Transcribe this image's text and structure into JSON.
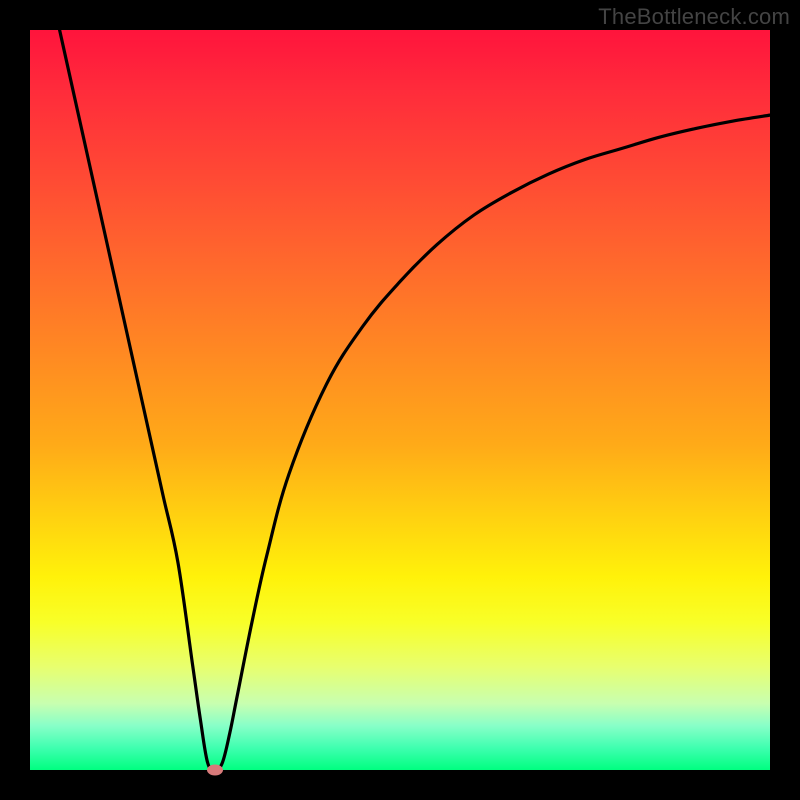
{
  "watermark": "TheBottleneck.com",
  "chart_data": {
    "type": "line",
    "title": "",
    "xlabel": "",
    "ylabel": "",
    "xlim": [
      0,
      100
    ],
    "ylim": [
      0,
      100
    ],
    "grid": false,
    "legend": false,
    "series": [
      {
        "name": "curve",
        "x": [
          4,
          6,
          8,
          10,
          12,
          14,
          16,
          18,
          20,
          22,
          23,
          24,
          25,
          26,
          27,
          28,
          30,
          32,
          35,
          40,
          45,
          50,
          55,
          60,
          65,
          70,
          75,
          80,
          85,
          90,
          95,
          100
        ],
        "y": [
          100,
          91,
          82,
          73,
          64,
          55,
          46,
          37,
          28,
          14,
          7,
          1,
          0,
          1,
          5,
          10,
          20,
          29,
          40,
          52,
          60,
          66,
          71,
          75,
          78,
          80.5,
          82.5,
          84,
          85.5,
          86.7,
          87.7,
          88.5
        ]
      }
    ],
    "marker": {
      "x": 25,
      "y": 0
    }
  },
  "colors": {
    "curve": "#000000",
    "marker": "#d87a7a",
    "background_top": "#ff143c",
    "background_bottom": "#00ff80",
    "frame": "#000000"
  }
}
